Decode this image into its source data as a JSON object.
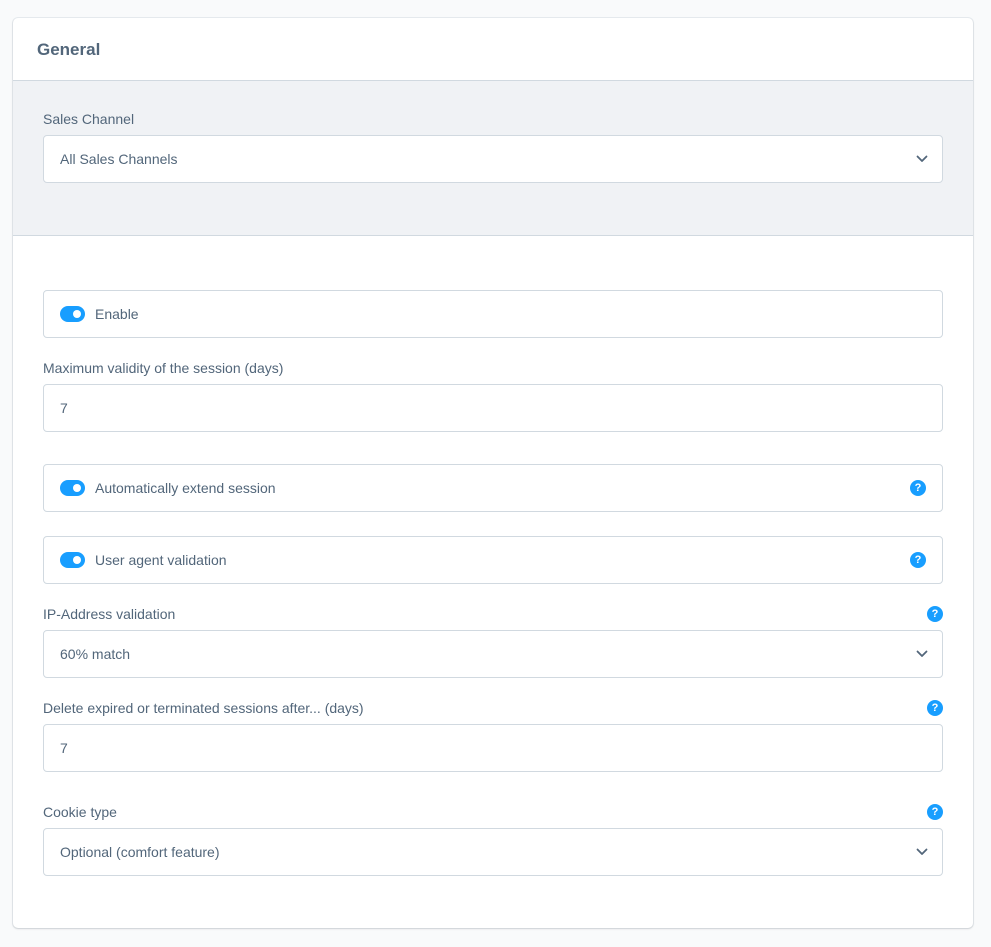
{
  "header": {
    "title": "General"
  },
  "sales_channel": {
    "label": "Sales Channel",
    "value": "All Sales Channels"
  },
  "enable": {
    "label": "Enable",
    "checked": true
  },
  "max_validity": {
    "label": "Maximum validity of the session (days)",
    "value": "7"
  },
  "auto_extend": {
    "label": "Automatically extend session",
    "checked": true
  },
  "user_agent": {
    "label": "User agent validation",
    "checked": true
  },
  "ip_validation": {
    "label": "IP-Address validation",
    "value": "60% match"
  },
  "delete_after": {
    "label": "Delete expired or terminated sessions after... (days)",
    "value": "7"
  },
  "cookie_type": {
    "label": "Cookie type",
    "value": "Optional (comfort feature)"
  },
  "colors": {
    "accent": "#189eff",
    "text": "#52667a",
    "border": "#d1d9e0",
    "section_bg": "#f0f2f5"
  },
  "icons": {
    "help": "help-circle-icon",
    "help_glyph": "?",
    "chevron": "chevron-down-icon"
  }
}
